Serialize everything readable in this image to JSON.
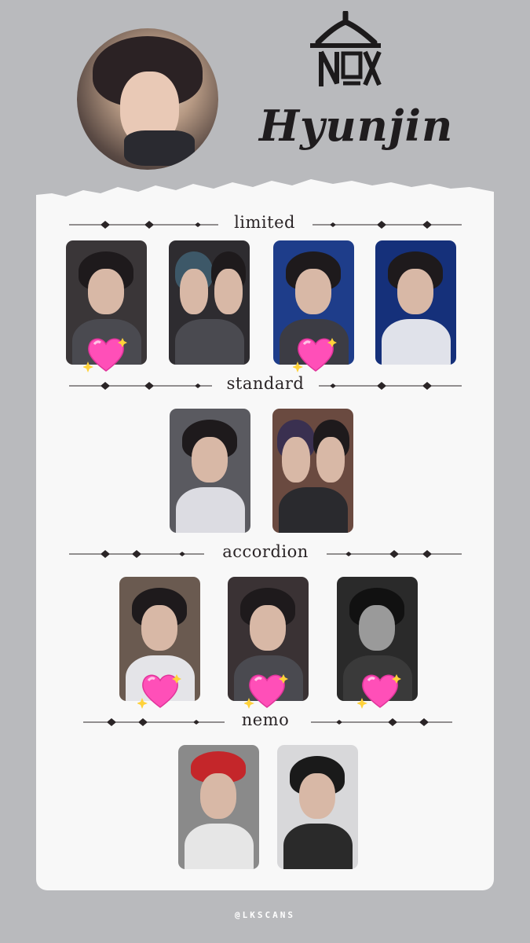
{
  "header": {
    "name": "Hyunjin",
    "logo_icon": "ate-album-logo-icon"
  },
  "sections": {
    "limited": {
      "title": "limited"
    },
    "standard": {
      "title": "standard"
    },
    "accordion": {
      "title": "accordion"
    },
    "nemo": {
      "title": "nemo"
    }
  },
  "colors": {
    "background": "#b9babd",
    "card": "#f8f8f8",
    "heart": "#ff4fb8",
    "text": "#2a2426"
  },
  "footer": {
    "handle": "@LKSCANS"
  }
}
